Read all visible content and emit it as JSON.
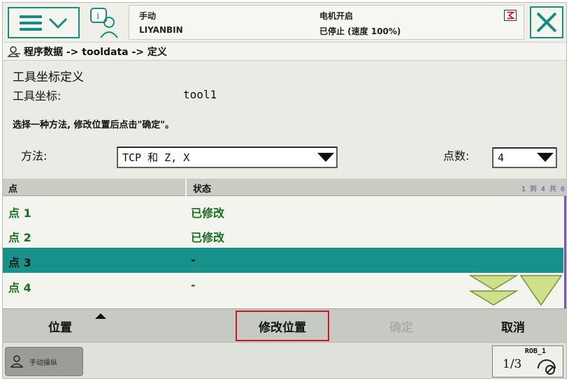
{
  "topbar": {
    "mode": "手动",
    "user": "LIYANBIN",
    "motor_state": "电机开启",
    "run_state": "已停止 (速度 100%)"
  },
  "breadcrumb": {
    "path": "程序数据 -> tooldata -> 定义"
  },
  "content": {
    "title": "工具坐标定义",
    "tool_label": "工具坐标:",
    "tool_value": "tool1",
    "instruction": "选择一种方法, 修改位置后点击\"确定\"。",
    "method_label": "方法:",
    "method_value": "TCP 和 Z, X",
    "count_label": "点数:",
    "count_value": "4"
  },
  "table": {
    "col_point": "点",
    "col_status": "状态",
    "pager": "1 到 4 共 6",
    "rows": [
      {
        "point": "点  1",
        "status": "已修改",
        "selected": false
      },
      {
        "point": "点  2",
        "status": "已修改",
        "selected": false
      },
      {
        "point": "点  3",
        "status": "-",
        "selected": true
      },
      {
        "point": "点  4",
        "status": "-",
        "selected": false
      }
    ]
  },
  "bottom": {
    "position": "位置",
    "modify_position": "修改位置",
    "ok": "确定",
    "cancel": "取消"
  },
  "statusbar": {
    "task": "手动操纵",
    "rob_name": "ROB_1",
    "rob_fraction": "1/3"
  },
  "colors": {
    "accent": "#188a82",
    "selected_row": "#17918a",
    "status_green": "#176f20",
    "highlight_outline": "#c81c1c",
    "scroll_arrow": "#cfe08a"
  }
}
